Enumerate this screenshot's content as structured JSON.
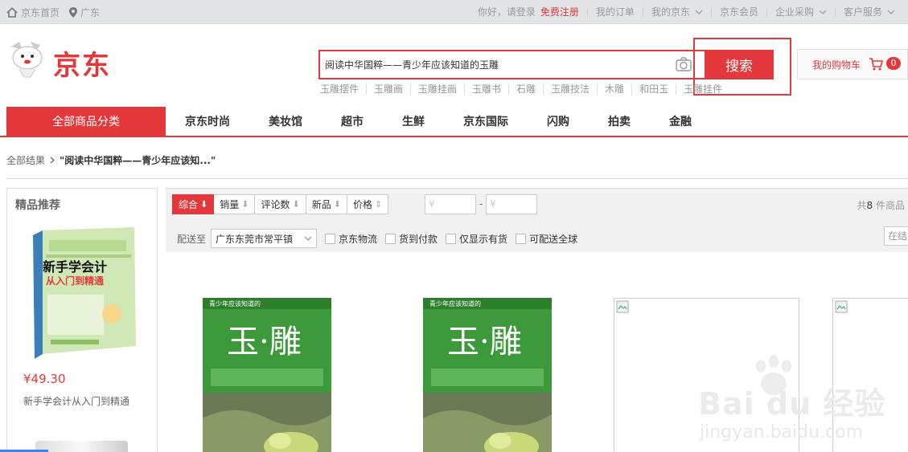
{
  "topbar": {
    "home": "京东首页",
    "location": "广东",
    "greeting": "你好，请登录",
    "register": "免费注册",
    "orders": "我的订单",
    "my_jd": "我的京东",
    "member": "京东会员",
    "enterprise": "企业采购",
    "service": "客户服务"
  },
  "header": {
    "logo_text": "京东",
    "search_value": "阅读中华国粹——青少年应该知道的玉雕",
    "search_button": "搜索",
    "cart_label": "我的购物车",
    "cart_count": "0",
    "hotwords": [
      "玉雕摆件",
      "玉雕画",
      "玉雕挂画",
      "玉雕书",
      "石雕",
      "玉雕技法",
      "木雕",
      "和田玉",
      "玉雕挂件"
    ]
  },
  "nav": {
    "all_categories": "全部商品分类",
    "items": [
      "京东时尚",
      "美妆馆",
      "超市",
      "生鲜",
      "京东国际",
      "闪购",
      "拍卖",
      "金融"
    ]
  },
  "breadcrumb": {
    "root": "全部结果",
    "query": "\"阅读中华国粹——青少年应该知...\""
  },
  "recommend": {
    "title": "精品推荐",
    "book_cover_title": "新手学会计",
    "book_cover_sub": "从入门到精通",
    "price": "¥49.30",
    "name": "新手学会计从入门到精通"
  },
  "filter": {
    "sorts": [
      {
        "label": "综合",
        "arrow": "⬇"
      },
      {
        "label": "销量",
        "arrow": "⬇"
      },
      {
        "label": "评论数",
        "arrow": "⬇"
      },
      {
        "label": "新品",
        "arrow": "⬇"
      },
      {
        "label": "价格",
        "arrow": "⇕"
      }
    ],
    "price_min_placeholder": "¥",
    "price_max_placeholder": "¥",
    "price_dash": "-",
    "count_prefix": "共",
    "count_value": "8",
    "count_suffix": "件商品",
    "ship_to_label": "配送至",
    "ship_to_value": "广东东莞市常平镇",
    "checkboxes": [
      "京东物流",
      "货到付款",
      "仅显示有货",
      "可配送全球"
    ],
    "in_result_placeholder": "在结果中搜索"
  },
  "products": {
    "cover_title": "玉·雕",
    "cover_series": "青少年应该知道的"
  },
  "watermark": {
    "brand": "Bai du 经验",
    "url": "jingyan.baidu.com"
  },
  "colors": {
    "brand_red": "#e4393c",
    "cover_green": "#3d9a3a"
  }
}
